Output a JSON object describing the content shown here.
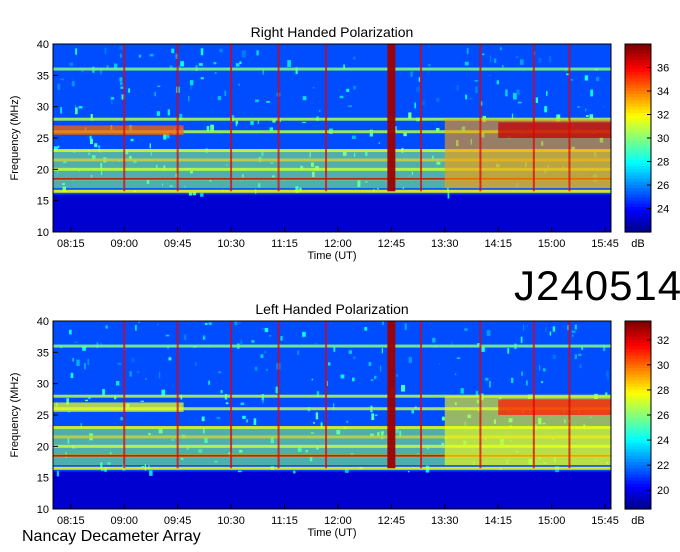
{
  "observation_id": "J240514",
  "footer": "Nancay Decameter Array",
  "chart_data": [
    {
      "type": "heatmap",
      "title": "Right Handed Polarization",
      "xlabel": "Time (UT)",
      "ylabel": "Frequency (MHz)",
      "x_ticks": [
        "08:15",
        "09:00",
        "09:45",
        "10:30",
        "11:15",
        "12:00",
        "12:45",
        "13:30",
        "14:15",
        "15:00",
        "15:45"
      ],
      "y_ticks": [
        10,
        15,
        20,
        25,
        30,
        35,
        40
      ],
      "ylim": [
        10,
        40
      ],
      "colorbar": {
        "unit": "dB",
        "ticks": [
          24,
          26,
          28,
          30,
          32,
          34,
          36
        ],
        "range": [
          22,
          38
        ]
      },
      "features": {
        "vertical_bursts_time": [
          "09:00",
          "09:45",
          "10:30",
          "11:10",
          "11:50",
          "12:45",
          "13:10",
          "14:00",
          "14:45",
          "15:15"
        ],
        "horizontal_bands_mhz": [
          16.5,
          18.5,
          20,
          21.5,
          23,
          26,
          28,
          36
        ],
        "main_burst_time": "12:45"
      }
    },
    {
      "type": "heatmap",
      "title": "Left Handed Polarization",
      "xlabel": "Time (UT)",
      "ylabel": "Frequency (MHz)",
      "x_ticks": [
        "08:15",
        "09:00",
        "09:45",
        "10:30",
        "11:15",
        "12:00",
        "12:45",
        "13:30",
        "14:15",
        "15:00",
        "15:45"
      ],
      "y_ticks": [
        10,
        15,
        20,
        25,
        30,
        35,
        40
      ],
      "ylim": [
        10,
        40
      ],
      "colorbar": {
        "unit": "dB",
        "ticks": [
          20,
          22,
          24,
          26,
          28,
          30,
          32
        ],
        "range": [
          18.5,
          33.5
        ]
      },
      "features": {
        "vertical_bursts_time": [
          "09:00",
          "09:45",
          "10:30",
          "11:10",
          "11:50",
          "12:45",
          "13:10",
          "14:00",
          "14:45",
          "15:15"
        ],
        "horizontal_bands_mhz": [
          16.5,
          18.5,
          20,
          21.5,
          23,
          26,
          28,
          36
        ],
        "main_burst_time": "12:45"
      }
    }
  ]
}
